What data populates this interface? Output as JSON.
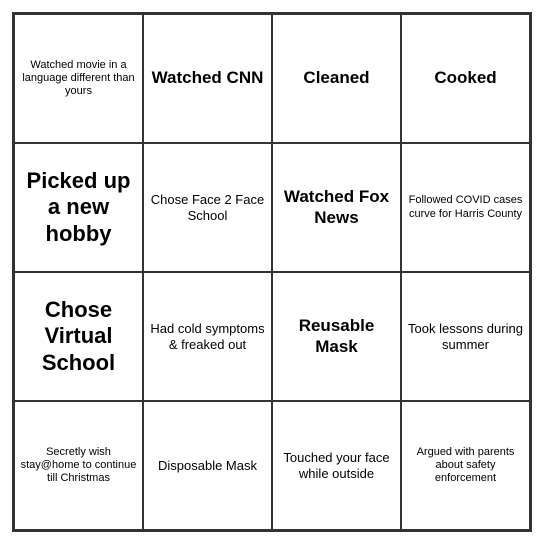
{
  "cells": [
    {
      "id": "r0c0",
      "text": "Watched movie in a language different than yours",
      "size": "small"
    },
    {
      "id": "r0c1",
      "text": "Watched CNN",
      "size": "medium"
    },
    {
      "id": "r0c2",
      "text": "Cleaned",
      "size": "medium"
    },
    {
      "id": "r0c3",
      "text": "Cooked",
      "size": "medium"
    },
    {
      "id": "r1c0",
      "text": "Picked up a new hobby",
      "size": "large"
    },
    {
      "id": "r1c1",
      "text": "Chose Face 2 Face School",
      "size": "normal"
    },
    {
      "id": "r1c2",
      "text": "Watched Fox News",
      "size": "medium"
    },
    {
      "id": "r1c3",
      "text": "Followed COVID cases curve for Harris County",
      "size": "small"
    },
    {
      "id": "r2c0",
      "text": "Chose Virtual School",
      "size": "large"
    },
    {
      "id": "r2c1",
      "text": "Had cold symptoms & freaked out",
      "size": "normal"
    },
    {
      "id": "r2c2",
      "text": "Reusable Mask",
      "size": "medium"
    },
    {
      "id": "r2c3",
      "text": "Took lessons during summer",
      "size": "normal"
    },
    {
      "id": "r3c0",
      "text": "Secretly wish stay@home to continue till Christmas",
      "size": "small"
    },
    {
      "id": "r3c1",
      "text": "Disposable Mask",
      "size": "normal"
    },
    {
      "id": "r3c2",
      "text": "Touched your face while outside",
      "size": "normal"
    },
    {
      "id": "r3c3",
      "text": "Argued with parents about safety enforcement",
      "size": "small"
    }
  ]
}
